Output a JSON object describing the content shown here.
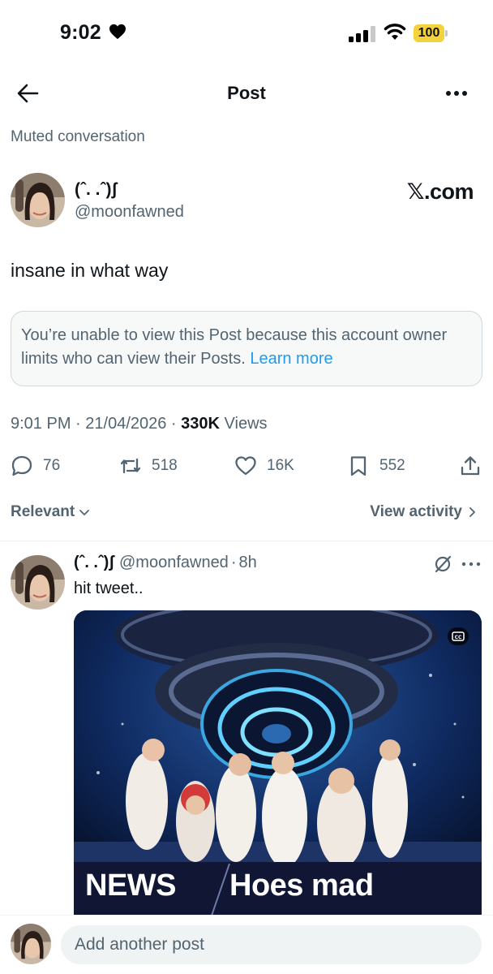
{
  "status_bar": {
    "time": "9:02",
    "battery": "100",
    "battery_color": "#f4d23b"
  },
  "header": {
    "title": "Post"
  },
  "muted_label": "Muted conversation",
  "post": {
    "author_name": "(ˆ. .ˆ)ʃ",
    "author_handle": "@moonfawned",
    "source_badge": "𝕏.com",
    "text": "insane in what way",
    "notice": {
      "text": "You’re unable to view this Post because this account owner limits who can view their Posts.",
      "link": "Learn more"
    },
    "time": "9:01 PM",
    "date": "21/04/2026",
    "views_count": "330K",
    "views_label": "Views",
    "actions": {
      "replies": "76",
      "reposts": "518",
      "likes": "16K",
      "bookmarks": "552"
    }
  },
  "sort": {
    "relevant_label": "Relevant",
    "view_activity_label": "View activity"
  },
  "reply": {
    "author_name": "(ˆ. .ˆ)ʃ",
    "author_handle": "@moonfawned",
    "time": "8h",
    "text": "hit tweet..",
    "media": {
      "news_label": "NEWS",
      "caption": "Hoes mad"
    }
  },
  "composer": {
    "placeholder": "Add another post"
  },
  "colors": {
    "accent": "#1d9bf0",
    "secondary_text": "#536471",
    "primary_text": "#0f1419"
  }
}
